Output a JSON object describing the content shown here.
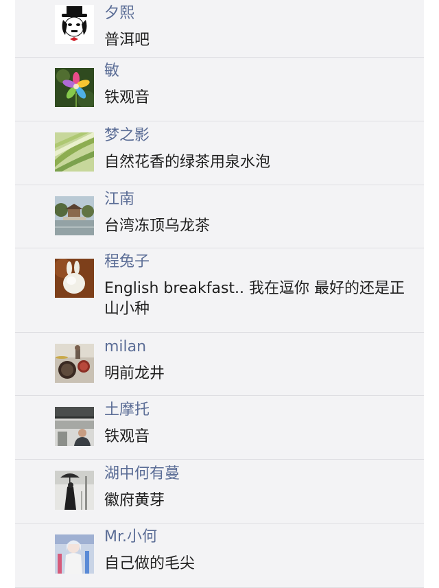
{
  "comments": [
    {
      "author": "夕熙",
      "message": "普洱吧",
      "avatar_icon": "chaplin-avatar-icon"
    },
    {
      "author": "敏",
      "message": "铁观音",
      "avatar_icon": "flower-avatar-icon"
    },
    {
      "author": "梦之影",
      "message": "自然花香的绿茶用泉水泡",
      "avatar_icon": "green-blur-avatar-icon"
    },
    {
      "author": "江南",
      "message": "台湾冻顶乌龙茶",
      "avatar_icon": "pavilion-avatar-icon"
    },
    {
      "author": "程兔子",
      "message": "English breakfast.. 我在逗你 最好的还是正山小种",
      "avatar_icon": "bunny-avatar-icon"
    },
    {
      "author": "milan",
      "message": "明前龙井",
      "avatar_icon": "drums-avatar-icon"
    },
    {
      "author": "土摩托",
      "message": "铁观音",
      "avatar_icon": "portrait-avatar-icon"
    },
    {
      "author": "湖中何有蔓",
      "message": "徽府黄芽",
      "avatar_icon": "umbrella-avatar-icon"
    },
    {
      "author": "Mr.小何",
      "message": "自己做的毛尖",
      "avatar_icon": "cartoon-avatar-icon"
    }
  ],
  "colors": {
    "author": "#5b6d96",
    "message": "#1f1f1f",
    "panel_background": "#f3f3f5",
    "divider": "#dedee2"
  }
}
